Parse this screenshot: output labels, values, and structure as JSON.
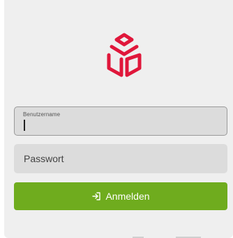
{
  "brand": {
    "logo_icon": "box-outline-logo",
    "accent_color": "#e0173b"
  },
  "login_form": {
    "username": {
      "label": "Benutzername",
      "value": ""
    },
    "password": {
      "placeholder": "Passwort",
      "value": ""
    },
    "submit": {
      "label": "Anmelden",
      "icon": "login-arrow-icon",
      "color": "#6fac1e"
    }
  }
}
